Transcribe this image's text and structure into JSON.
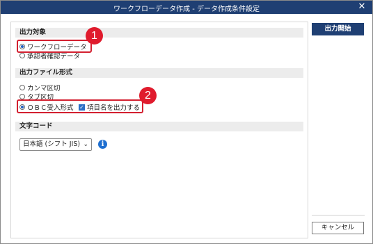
{
  "window": {
    "title": "ワークフローデータ作成 - データ作成条件設定",
    "close_icon": "close-icon"
  },
  "sections": {
    "output_target": {
      "heading": "出力対象",
      "options": [
        {
          "label": "ワークフローデータ",
          "selected": true
        },
        {
          "label": "承認者確認データ",
          "selected": false
        }
      ]
    },
    "file_format": {
      "heading": "出力ファイル形式",
      "options": [
        {
          "label": "カンマ区切",
          "selected": false
        },
        {
          "label": "タブ区切",
          "selected": false
        },
        {
          "label": "ＯＢＣ受入形式",
          "selected": true
        }
      ],
      "checkbox": {
        "label": "項目名を出力する",
        "checked": true
      }
    },
    "charset": {
      "heading": "文字コード",
      "selected": "日本語 (シフト JIS)"
    }
  },
  "buttons": {
    "start": "出力開始",
    "cancel": "キャンセル"
  },
  "annotations": [
    "1",
    "2"
  ],
  "colors": {
    "titlebar": "#1f3f73",
    "highlight": "#d32030",
    "badge": "#e01b2d",
    "info": "#1f6fd0"
  }
}
